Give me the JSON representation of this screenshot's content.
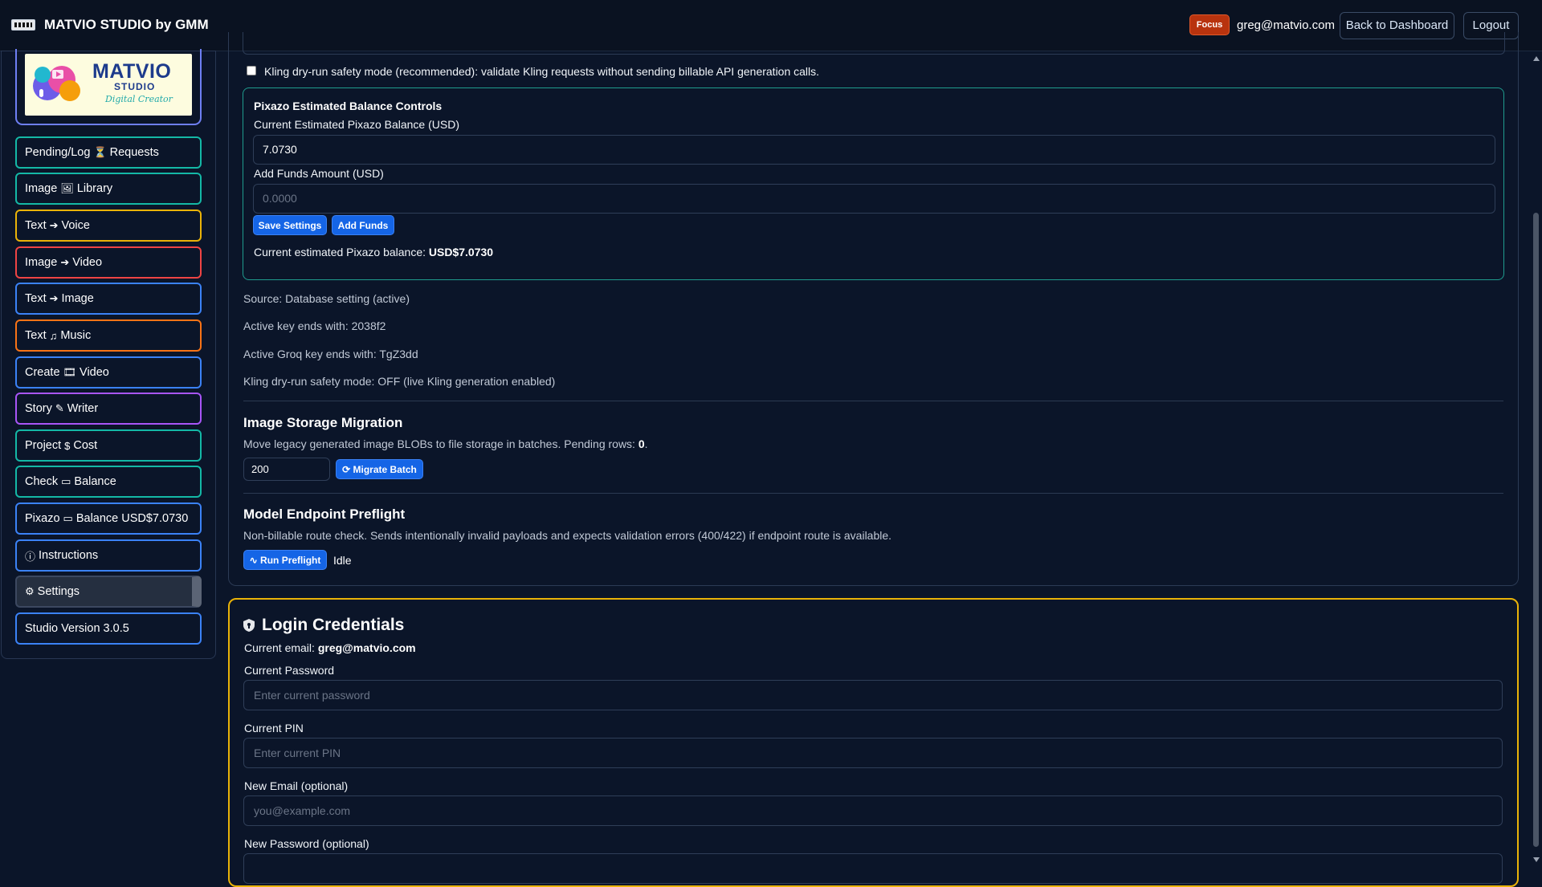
{
  "header": {
    "brand": "MATVIO STUDIO by GMM",
    "focus_badge": "Focus",
    "user_email": "greg@matvio.com",
    "back_label": "Back to Dashboard",
    "logout_label": "Logout"
  },
  "logo": {
    "title": "MATVIO",
    "subtitle": "STUDIO",
    "tagline": "Digital Creator"
  },
  "sidebar": {
    "items": [
      {
        "pre": "Pending/Log",
        "icon": "hourglass-icon",
        "glyph": "⏳",
        "post": "Requests",
        "color": "#14b8a6"
      },
      {
        "pre": "Image",
        "icon": "image-icon",
        "glyph": "🖼",
        "post": "Library",
        "color": "#14b8a6"
      },
      {
        "pre": "Text",
        "icon": "arrow-circle-icon",
        "glyph": "➔",
        "post": "Voice",
        "color": "#eab308"
      },
      {
        "pre": "Image",
        "icon": "arrow-circle-icon",
        "glyph": "➔",
        "post": "Video",
        "color": "#ef4444"
      },
      {
        "pre": "Text",
        "icon": "arrow-circle-icon",
        "glyph": "➔",
        "post": "Image",
        "color": "#3b82f6"
      },
      {
        "pre": "Text",
        "icon": "music-icon",
        "glyph": "♫",
        "post": "Music",
        "color": "#f97316"
      },
      {
        "pre": "Create",
        "icon": "film-icon",
        "glyph": "🎞",
        "post": "Video",
        "color": "#3b82f6"
      },
      {
        "pre": "Story",
        "icon": "pencil-square-icon",
        "glyph": "✎",
        "post": "Writer",
        "color": "#a855f7"
      },
      {
        "pre": "Project",
        "icon": "dollar-icon",
        "glyph": "$",
        "post": "Cost",
        "color": "#14b8a6"
      },
      {
        "pre": "Check",
        "icon": "wallet-icon",
        "glyph": "▭",
        "post": "Balance",
        "color": "#14b8a6"
      },
      {
        "pre": "Pixazo",
        "icon": "wallet-icon",
        "glyph": "▭",
        "post": "Balance USD$7.0730",
        "color": "#3b82f6"
      },
      {
        "pre": "",
        "icon": "info-icon",
        "glyph": "ⓘ",
        "post": "Instructions",
        "color": "#3b82f6"
      },
      {
        "pre": "",
        "icon": "gear-icon",
        "glyph": "⚙",
        "post": "Settings",
        "color": "#3c4860"
      },
      {
        "pre": "Studio Version 3.0.5",
        "icon": "",
        "glyph": "",
        "post": "",
        "color": "#3b82f6"
      }
    ]
  },
  "kling": {
    "checkbox_label": "Kling dry-run safety mode (recommended): validate Kling requests without sending billable API generation calls."
  },
  "pixazo": {
    "title": "Pixazo Estimated Balance Controls",
    "balance_label": "Current Estimated Pixazo Balance (USD)",
    "balance_value": "7.0730",
    "add_label": "Add Funds Amount (USD)",
    "add_placeholder": "0.0000",
    "save_label": "Save Settings",
    "add_button": "Add Funds",
    "current_prefix": "Current estimated Pixazo balance:",
    "current_value": "USD$7.0730"
  },
  "status": {
    "source": "Source: Database setting (active)",
    "key": "Active key ends with: 2038f2",
    "groq": "Active Groq key ends with: TgZ3dd",
    "kling_mode": "Kling dry-run safety mode: OFF (live Kling generation enabled)"
  },
  "migration": {
    "title": "Image Storage Migration",
    "desc_prefix": "Move legacy generated image BLOBs to file storage in batches. Pending rows:",
    "pending": "0",
    "desc_suffix": ".",
    "batch_value": "200",
    "button": "Migrate Batch"
  },
  "preflight": {
    "title": "Model Endpoint Preflight",
    "desc": "Non-billable route check. Sends intentionally invalid payloads and expects validation errors (400/422) if endpoint route is available.",
    "button": "Run Preflight",
    "state": "Idle"
  },
  "login": {
    "title": "Login Credentials",
    "email_prefix": "Current email:",
    "email": "greg@matvio.com",
    "current_password_label": "Current Password",
    "current_password_placeholder": "Enter current password",
    "current_pin_label": "Current PIN",
    "current_pin_placeholder": "Enter current PIN",
    "new_email_label": "New Email (optional)",
    "new_email_placeholder": "you@example.com",
    "new_password_label": "New Password (optional)"
  }
}
